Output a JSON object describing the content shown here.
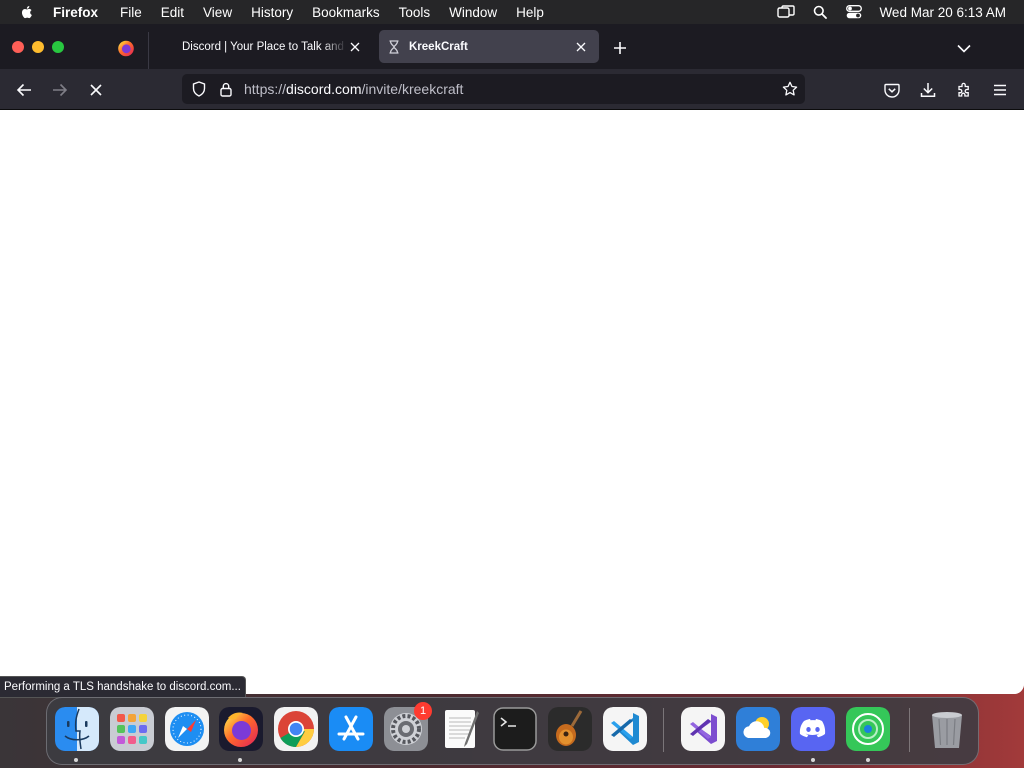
{
  "menubar": {
    "app_name": "Firefox",
    "items": [
      "File",
      "Edit",
      "View",
      "History",
      "Bookmarks",
      "Tools",
      "Window",
      "Help"
    ],
    "clock": "Wed Mar 20  6:13 AM"
  },
  "tabs": [
    {
      "title": "Discord | Your Place to Talk and Hang Out",
      "active": false
    },
    {
      "title": "KreekCraft",
      "active": true
    }
  ],
  "urlbar": {
    "scheme": "https://",
    "host": "discord.com",
    "path": "/invite/kreekcraft"
  },
  "status_text": "Performing a TLS handshake to discord.com...",
  "dock": {
    "apps": [
      "Finder",
      "Launchpad",
      "Safari",
      "Firefox",
      "Google Chrome",
      "App Store",
      "System Preferences",
      "TextEdit",
      "Terminal",
      "GarageBand",
      "Visual Studio Code",
      "Visual Studio",
      "Weather",
      "Discord",
      "Find My",
      "Trash"
    ],
    "system_preferences_badge": "1"
  },
  "colors": {
    "menubar": "#262628",
    "tabbar": "#1c1b22",
    "navbar": "#2b2a33",
    "active_tab": "#42414d",
    "page": "#ffffff"
  }
}
